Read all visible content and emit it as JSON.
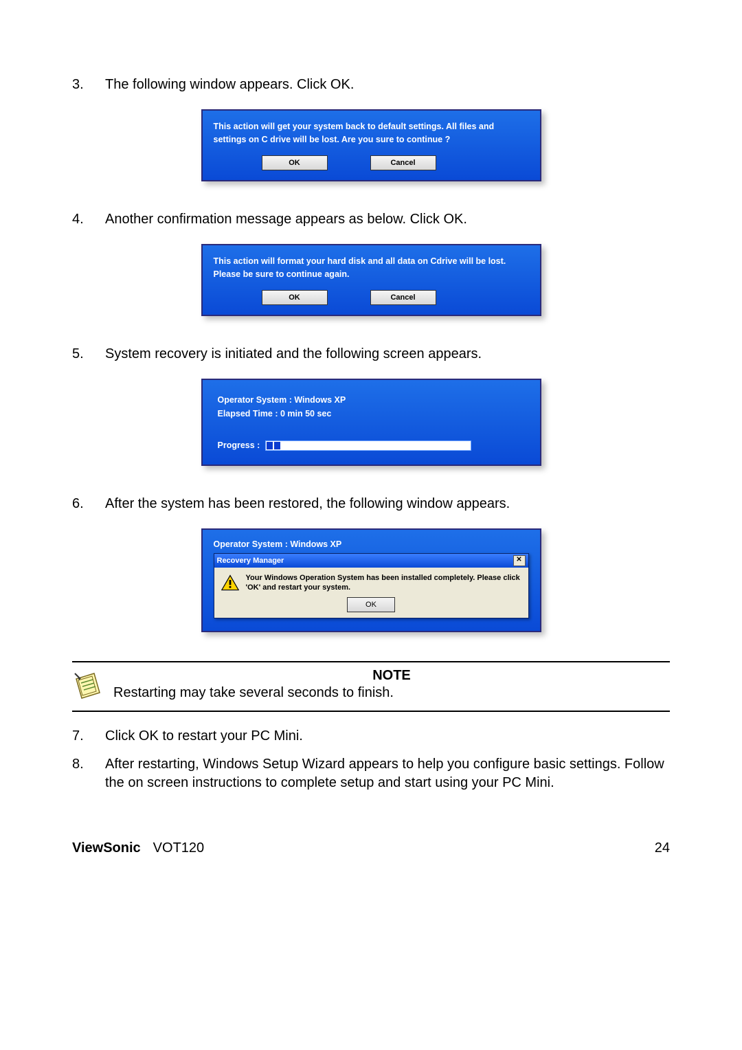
{
  "steps": {
    "s3": {
      "num": "3.",
      "text": "The following window appears. Click OK."
    },
    "s4": {
      "num": "4.",
      "text": "Another confirmation message appears as below. Click OK."
    },
    "s5": {
      "num": "5.",
      "text": "System recovery is initiated and the following screen appears."
    },
    "s6": {
      "num": "6.",
      "text": "After the system has been restored, the following window appears."
    },
    "s7": {
      "num": "7.",
      "text": "Click OK to restart your PC Mini."
    },
    "s8": {
      "num": "8.",
      "text": "After restarting, Windows Setup Wizard appears to help you configure basic settings. Follow the on screen instructions to complete setup and start using your PC Mini."
    }
  },
  "dialog1": {
    "message": "This action will get your system back to default settings. All files and settings on C drive will be lost. Are you sure to continue ?",
    "ok": "OK",
    "cancel": "Cancel"
  },
  "dialog2": {
    "message": "This action will format your hard disk and all data on Cdrive will be lost. Please be sure to continue again.",
    "ok": "OK",
    "cancel": "Cancel"
  },
  "progress_panel": {
    "os_line": "Operator System :  Windows XP",
    "time_line": "Elapsed Time :   0 min 50 sec",
    "progress_label": "Progress :",
    "progress_chunks": 2
  },
  "completed_panel": {
    "os_line": "Operator System :  Windows XP",
    "dialog_title": "Recovery Manager",
    "dialog_text": "Your Windows Operation System has been installed completely. Please click 'OK' and restart your system.",
    "ok": "OK",
    "close_glyph": "✕"
  },
  "note": {
    "title": "NOTE",
    "text": "Restarting may take several seconds to finish."
  },
  "footer": {
    "brand": "ViewSonic",
    "model": "VOT120",
    "page": "24"
  }
}
